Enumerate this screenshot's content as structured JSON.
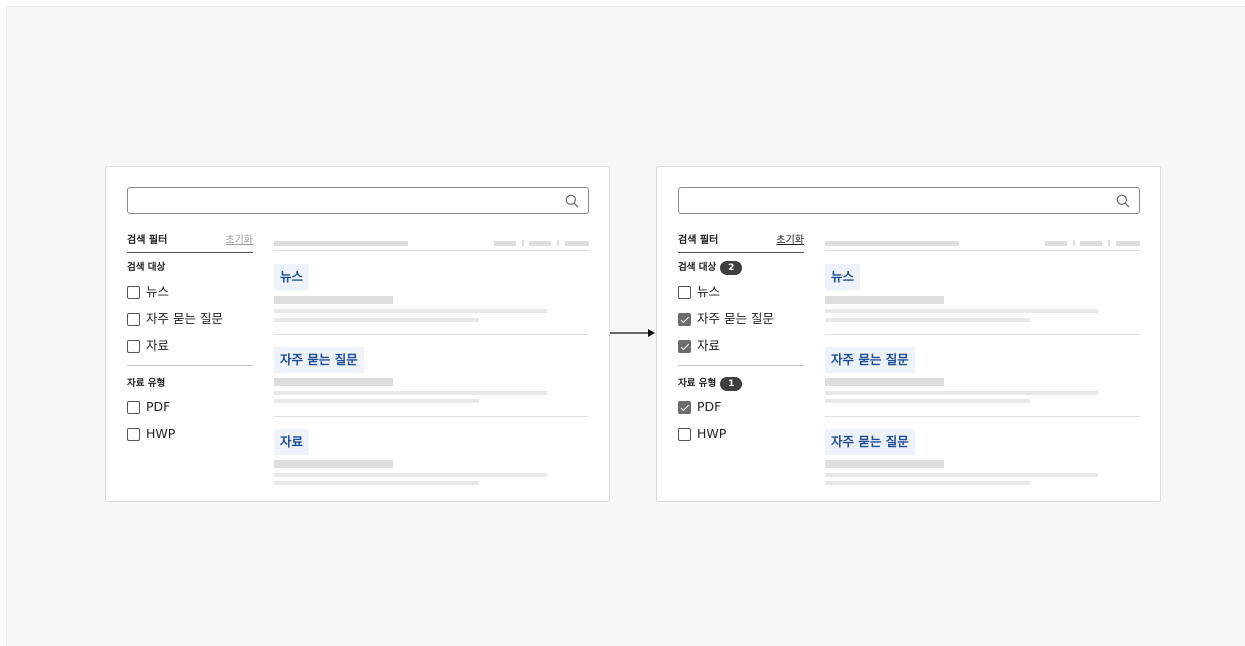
{
  "left_panel": {
    "search": {
      "placeholder": ""
    },
    "filter_title": "검색 필터",
    "reset_label": "초기화",
    "group1": {
      "title": "검색 대상",
      "options": [
        {
          "label": "뉴스",
          "checked": false
        },
        {
          "label": "자주 묻는 질문",
          "checked": false
        },
        {
          "label": "자료",
          "checked": false
        }
      ]
    },
    "group2": {
      "title": "자료 유형",
      "options": [
        {
          "label": "PDF",
          "checked": false
        },
        {
          "label": "HWP",
          "checked": false
        }
      ]
    },
    "results": [
      "뉴스",
      "자주 묻는 질문",
      "자료"
    ]
  },
  "right_panel": {
    "search": {
      "placeholder": ""
    },
    "filter_title": "검색 필터",
    "reset_label": "초기화",
    "group1": {
      "title": "검색 대상",
      "count": "2",
      "options": [
        {
          "label": "뉴스",
          "checked": false
        },
        {
          "label": "자주 묻는 질문",
          "checked": true
        },
        {
          "label": "자료",
          "checked": true
        }
      ]
    },
    "group2": {
      "title": "자료 유형",
      "count": "1",
      "options": [
        {
          "label": "PDF",
          "checked": true
        },
        {
          "label": "HWP",
          "checked": false
        }
      ]
    },
    "results": [
      "뉴스",
      "자주 묻는 질문",
      "자주 묻는 질문"
    ]
  },
  "icons": {
    "search": "search-icon",
    "transition": "arrow-right-icon"
  },
  "colors": {
    "tag_bg": "#eef3fb",
    "tag_text": "#1f4e99",
    "badge_bg": "#3f3f3f",
    "checked_bg": "#6c6c6c"
  }
}
